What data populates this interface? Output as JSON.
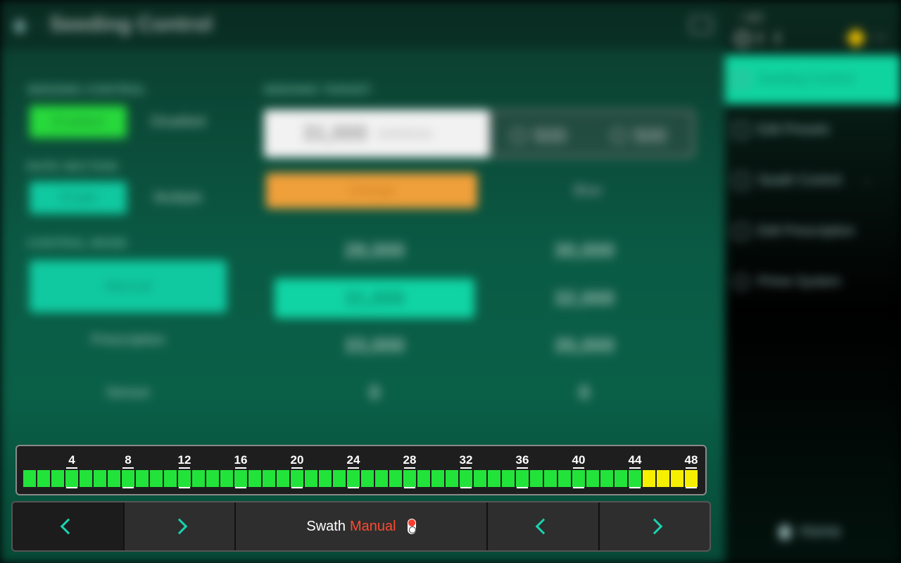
{
  "header": {
    "title": "Seeding Control",
    "speed": "-- mph",
    "icons": [
      "home-icon",
      "panel-toggle-icon",
      "gps-icon",
      "signal-icon",
      "warning-icon",
      "link-icon"
    ]
  },
  "seeding_control": {
    "label": "SEEDING CONTROL",
    "options": [
      "Enabled",
      "Disabled"
    ],
    "selected": "Enabled"
  },
  "rate_section": {
    "label": "RATE SECTION",
    "options": [
      "Single",
      "Multiple"
    ],
    "selected": "Single"
  },
  "control_mode": {
    "label": "CONTROL MODE",
    "options": [
      "Manual",
      "Prescription",
      "Sensor"
    ],
    "selected": "Manual"
  },
  "seeding_target": {
    "label": "SEEDING TARGET",
    "value": "31,000",
    "unit": "seeds/ac",
    "decrement": "500",
    "increment": "500"
  },
  "presets": {
    "columns": [
      "Orange",
      "Blue"
    ],
    "selected_column": "Orange",
    "orange": [
      "28,000",
      "31,000",
      "33,000",
      "0"
    ],
    "blue": [
      "30,000",
      "32,000",
      "35,000",
      "0"
    ],
    "selected_rate": "31,000"
  },
  "side_menu": {
    "items": [
      "Seeding Control",
      "Edit Presets",
      "Swath Control",
      "Edit Prescription",
      "Prime System"
    ],
    "active": "Seeding Control",
    "home": "Home"
  },
  "swath": {
    "total_sections": 48,
    "tick_labels": [
      "4",
      "8",
      "12",
      "16",
      "20",
      "24",
      "28",
      "32",
      "36",
      "40",
      "44",
      "48"
    ],
    "sections_on": 44,
    "colors": {
      "on": "#22e33a",
      "partial": "#f7ef00",
      "track": "#1e1e1e"
    }
  },
  "controls": {
    "swath_label": "Swath",
    "swath_mode": "Manual",
    "mode_color": "#ff4a2e",
    "accent": "#19d3b0"
  }
}
